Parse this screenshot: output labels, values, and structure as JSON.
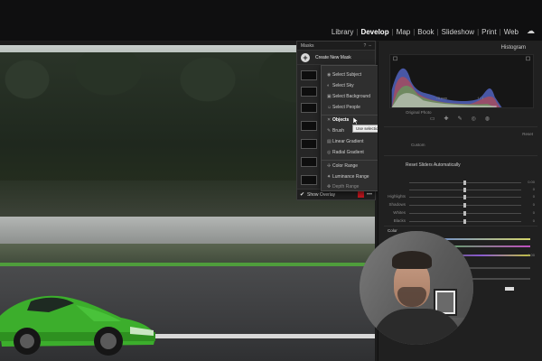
{
  "topbar": {
    "modules": [
      {
        "label": "Library",
        "active": false
      },
      {
        "label": "Develop",
        "active": true
      },
      {
        "label": "Map",
        "active": false
      },
      {
        "label": "Book",
        "active": false
      },
      {
        "label": "Slideshow",
        "active": false
      },
      {
        "label": "Print",
        "active": false
      },
      {
        "label": "Web",
        "active": false
      }
    ],
    "cloud_icon": "cloud-icon"
  },
  "masks_panel": {
    "title": "Masks",
    "create_label": "Create New Mask",
    "mask_prefix": "Ma",
    "show_overlay_label": "Show Overlay",
    "overlay_color": "#c0161f"
  },
  "mask_menu": {
    "ai_items": [
      {
        "label": "Select Subject",
        "icon": "subject-icon"
      },
      {
        "label": "Select Sky",
        "icon": "sky-icon"
      },
      {
        "label": "Select Background",
        "icon": "background-icon"
      },
      {
        "label": "Select People",
        "icon": "people-icon"
      }
    ],
    "objects": {
      "label": "Objects",
      "icon": "objects-icon"
    },
    "tool_items": [
      {
        "label": "Brush",
        "shortcut": "K",
        "icon": "brush-icon"
      },
      {
        "label": "Linear Gradient",
        "shortcut": "(M)",
        "icon": "linear-gradient-icon"
      },
      {
        "label": "Radial Gradient",
        "shortcut": "(Shift+M)",
        "icon": "radial-gradient-icon"
      }
    ],
    "range_items": [
      {
        "label": "Color Range",
        "shortcut": "(Shift+J)",
        "icon": "color-range-icon"
      },
      {
        "label": "Luminance Range",
        "shortcut": "(Shift+Q)",
        "icon": "luminance-range-icon"
      },
      {
        "label": "Depth Range",
        "shortcut": "(Shift+Z)",
        "icon": "depth-range-icon"
      }
    ]
  },
  "tooltip": "Use selection tools to mask objects in the photo. Powered by AI",
  "histogram": {
    "title": "Histogram",
    "readouts": [
      "",
      "75 mm",
      "f / 1",
      ""
    ],
    "original_label": "Original Photo",
    "colors": [
      "#c24a4a",
      "#5a6ed6",
      "#55b05a",
      "#d9d9d9"
    ]
  },
  "right_panel": {
    "reset_label": "Reset",
    "custom_label": "Custom",
    "reset_auto_label": "Reset Sliders Automatically",
    "sliders": [
      {
        "label": "",
        "value": "0.00"
      },
      {
        "label": "",
        "value": "0"
      },
      {
        "label": "",
        "value": "0"
      },
      {
        "label": "Highlights",
        "value": "0"
      },
      {
        "label": "Shadows",
        "value": "0"
      },
      {
        "label": "Whites",
        "value": "0"
      },
      {
        "label": "Blacks",
        "value": "0"
      }
    ],
    "color_section": "Color",
    "color_value": "0.00"
  }
}
